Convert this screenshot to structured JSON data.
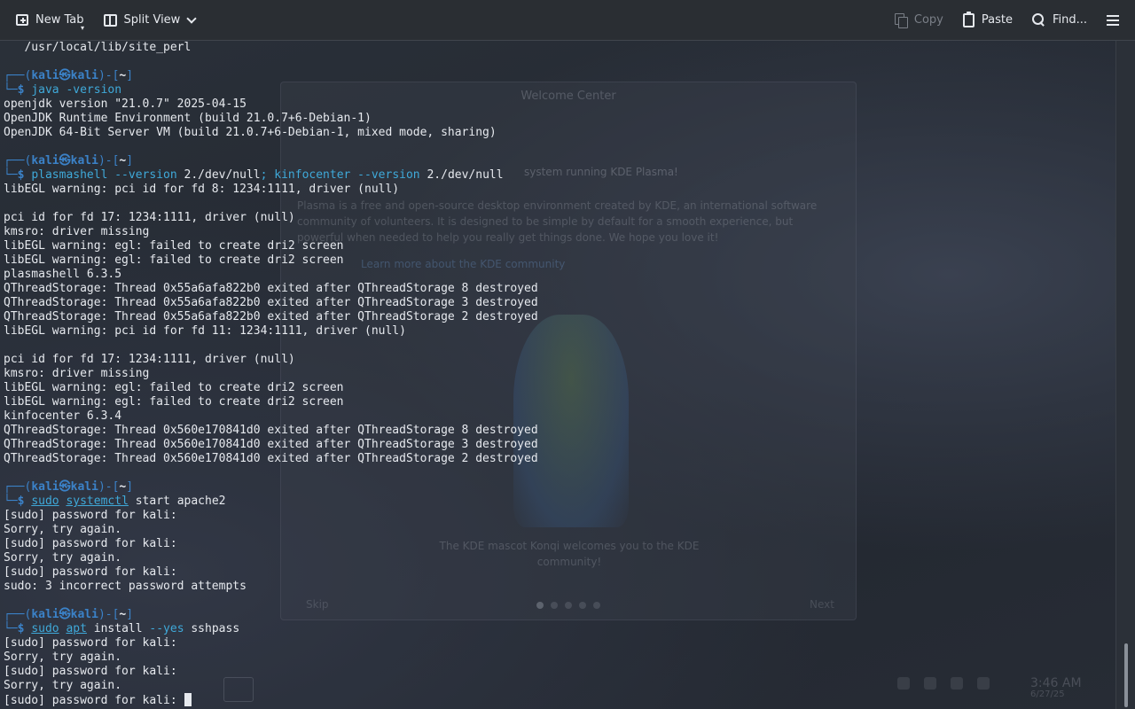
{
  "toolbar": {
    "new_tab": "New Tab",
    "split_view": "Split View",
    "copy": "Copy",
    "paste": "Paste",
    "find": "Find..."
  },
  "terminal": {
    "user": "kali",
    "host": "kali",
    "dir": "~",
    "lines": [
      {
        "type": "out",
        "text": "   /usr/local/lib/site_perl"
      },
      {
        "type": "blank"
      },
      {
        "type": "prompt"
      },
      {
        "type": "cmd",
        "parts": [
          [
            "cmd",
            "java"
          ],
          [
            "opt",
            " -version"
          ]
        ]
      },
      {
        "type": "out",
        "text": "openjdk version \"21.0.7\" 2025-04-15"
      },
      {
        "type": "out",
        "text": "OpenJDK Runtime Environment (build 21.0.7+6-Debian-1)"
      },
      {
        "type": "out",
        "text": "OpenJDK 64-Bit Server VM (build 21.0.7+6-Debian-1, mixed mode, sharing)"
      },
      {
        "type": "blank"
      },
      {
        "type": "prompt"
      },
      {
        "type": "cmd",
        "parts": [
          [
            "cmd",
            "plasmashell"
          ],
          [
            "opt",
            " --version"
          ],
          [
            "arg",
            " 2./dev/null"
          ],
          [
            "sep",
            ";"
          ],
          [
            "cmd",
            " kinfocenter"
          ],
          [
            "opt",
            " --version"
          ],
          [
            "arg",
            " 2./dev/null"
          ]
        ]
      },
      {
        "type": "out",
        "text": "libEGL warning: pci id for fd 8: 1234:1111, driver (null)"
      },
      {
        "type": "blank"
      },
      {
        "type": "out",
        "text": "pci id for fd 17: 1234:1111, driver (null)"
      },
      {
        "type": "out",
        "text": "kmsro: driver missing"
      },
      {
        "type": "out",
        "text": "libEGL warning: egl: failed to create dri2 screen"
      },
      {
        "type": "out",
        "text": "libEGL warning: egl: failed to create dri2 screen"
      },
      {
        "type": "out",
        "text": "plasmashell 6.3.5"
      },
      {
        "type": "out",
        "text": "QThreadStorage: Thread 0x55a6afa822b0 exited after QThreadStorage 8 destroyed"
      },
      {
        "type": "out",
        "text": "QThreadStorage: Thread 0x55a6afa822b0 exited after QThreadStorage 3 destroyed"
      },
      {
        "type": "out",
        "text": "QThreadStorage: Thread 0x55a6afa822b0 exited after QThreadStorage 2 destroyed"
      },
      {
        "type": "out",
        "text": "libEGL warning: pci id for fd 11: 1234:1111, driver (null)"
      },
      {
        "type": "blank"
      },
      {
        "type": "out",
        "text": "pci id for fd 17: 1234:1111, driver (null)"
      },
      {
        "type": "out",
        "text": "kmsro: driver missing"
      },
      {
        "type": "out",
        "text": "libEGL warning: egl: failed to create dri2 screen"
      },
      {
        "type": "out",
        "text": "libEGL warning: egl: failed to create dri2 screen"
      },
      {
        "type": "out",
        "text": "kinfocenter 6.3.4"
      },
      {
        "type": "out",
        "text": "QThreadStorage: Thread 0x560e170841d0 exited after QThreadStorage 8 destroyed"
      },
      {
        "type": "out",
        "text": "QThreadStorage: Thread 0x560e170841d0 exited after QThreadStorage 3 destroyed"
      },
      {
        "type": "out",
        "text": "QThreadStorage: Thread 0x560e170841d0 exited after QThreadStorage 2 destroyed"
      },
      {
        "type": "blank"
      },
      {
        "type": "prompt"
      },
      {
        "type": "cmd",
        "parts": [
          [
            "cmd-ul",
            "sudo"
          ],
          [
            "arg",
            " "
          ],
          [
            "cmd-ul",
            "systemctl"
          ],
          [
            "arg",
            " start apache2"
          ]
        ]
      },
      {
        "type": "out",
        "text": "[sudo] password for kali:"
      },
      {
        "type": "out",
        "text": "Sorry, try again."
      },
      {
        "type": "out",
        "text": "[sudo] password for kali:"
      },
      {
        "type": "out",
        "text": "Sorry, try again."
      },
      {
        "type": "out",
        "text": "[sudo] password for kali:"
      },
      {
        "type": "out",
        "text": "sudo: 3 incorrect password attempts"
      },
      {
        "type": "blank"
      },
      {
        "type": "prompt"
      },
      {
        "type": "cmd",
        "parts": [
          [
            "cmd-ul",
            "sudo"
          ],
          [
            "arg",
            " "
          ],
          [
            "cmd-ul",
            "apt"
          ],
          [
            "arg",
            " install"
          ],
          [
            "opt",
            " --yes"
          ],
          [
            "arg",
            " sshpass"
          ]
        ]
      },
      {
        "type": "out",
        "text": "[sudo] password for kali:"
      },
      {
        "type": "out",
        "text": "Sorry, try again."
      },
      {
        "type": "out",
        "text": "[sudo] password for kali:"
      },
      {
        "type": "out",
        "text": "Sorry, try again."
      },
      {
        "type": "cursorline",
        "text": "[sudo] password for kali: "
      }
    ]
  },
  "background_dialog": {
    "title": "Welcome Center",
    "heading": "system running KDE Plasma!",
    "body": "Plasma is a free and open-source desktop environment created by KDE, an international software community of volunteers. It is designed to be simple by default for a smooth experience, but powerful when needed to help you really get things done. We hope you love it!",
    "link": "Learn more about the KDE community",
    "caption": "The KDE mascot Konqi welcomes you to the KDE community!",
    "skip": "Skip",
    "next": "Next"
  },
  "taskbar": {
    "time": "3:46 AM",
    "date": "6/27/25"
  },
  "colors": {
    "prompt_frame": "#3b82c8",
    "command": "#3fa9d9",
    "text": "#e6e9ee",
    "background": "#262b33"
  }
}
